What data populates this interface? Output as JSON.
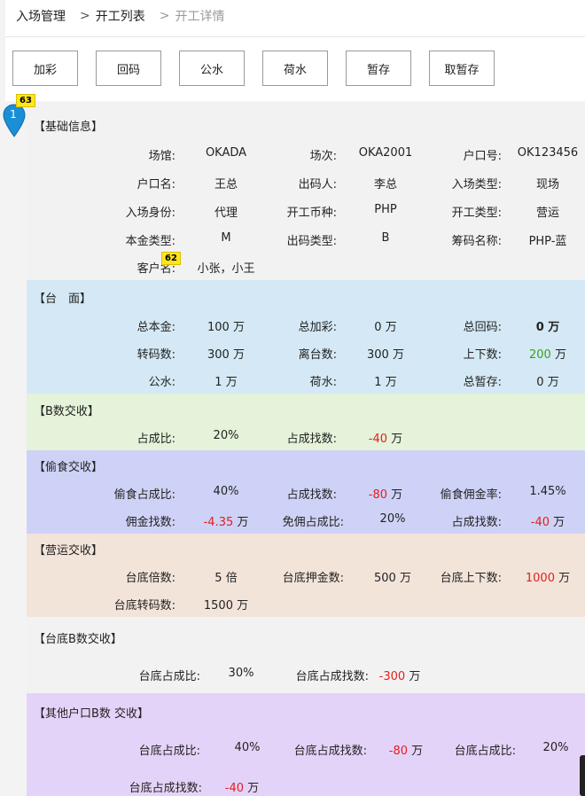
{
  "breadcrumb": {
    "home": "入场管理",
    "sep1": ">",
    "list": "开工列表",
    "sep2": ">",
    "current": "开工详情"
  },
  "toolbar": {
    "b1": "加彩",
    "b2": "回码",
    "b3": "公水",
    "b4": "荷水",
    "b5": "暂存",
    "b6": "取暂存"
  },
  "marker": {
    "label": "1",
    "badge": "63"
  },
  "badge2": "62",
  "basic": {
    "title": "【基础信息】",
    "venue_l": "场馆:",
    "venue_v": "OKADA",
    "session_l": "场次:",
    "session_v": "OKA2001",
    "acct_l": "户口号:",
    "acct_v": "OK123456",
    "name_l": "户口名:",
    "name_v": "王总",
    "issuer_l": "出码人:",
    "issuer_v": "李总",
    "entry_l": "入场类型:",
    "entry_v": "现场",
    "role_l": "入场身份:",
    "role_v": "代理",
    "currency_l": "开工币种:",
    "currency_v": "PHP",
    "worktype_l": "开工类型:",
    "worktype_v": "营运",
    "principal_l": "本金类型:",
    "principal_v": "M",
    "codetype_l": "出码类型:",
    "codetype_v": "B",
    "chipname_l": "筹码名称:",
    "chipname_v": "PHP-蓝",
    "client_l": "客户名:",
    "client_v": "小张，小王"
  },
  "table": {
    "title": "【台　面】",
    "r1": [
      "总本金:",
      "100 万",
      "总加彩:",
      "0 万",
      "总回码:",
      "0 万"
    ],
    "r2": [
      "转码数:",
      "300 万",
      "离台数:",
      "300 万",
      "上下数:",
      "200",
      "万"
    ],
    "r3": [
      "公水:",
      "1 万",
      "荷水:",
      "1 万",
      "总暂存:",
      "0 万"
    ]
  },
  "bsettle": {
    "title": "【B数交收】",
    "r1": [
      "占成比:",
      "20%",
      "占成找数:",
      "-40",
      "万"
    ]
  },
  "steal": {
    "title": "【偷食交收】",
    "r1": [
      "偷食占成比:",
      "40%",
      "占成找数:",
      "-80",
      "万",
      "偷食佣金率:",
      "1.45%"
    ],
    "r2": [
      "佣金找数:",
      "-4.35",
      "万",
      "免佣占成比:",
      "20%",
      "占成找数:",
      "-40",
      "万"
    ]
  },
  "ops": {
    "title": "【营运交收】",
    "r1": [
      "台底倍数:",
      "5 倍",
      "台底押金数:",
      "500 万",
      "台底上下数:",
      "1000",
      "万"
    ],
    "r2": [
      "台底转码数:",
      "1500 万"
    ]
  },
  "floorb": {
    "title": "【台底B数交收】",
    "r1": [
      "台底占成比:",
      "30%",
      "台底占成找数:",
      "-300",
      "万"
    ]
  },
  "other": {
    "title": "【其他户口B数 交收】",
    "r1": [
      "台底占成比:",
      "40%",
      "台底占成找数:",
      "-80",
      "万",
      "台底占成比:",
      "20%"
    ],
    "r2": [
      "台底占成找数:",
      "-40",
      "万"
    ]
  },
  "colors": {
    "basic": "#f2f2f2",
    "table": "#d4e9f5",
    "bsettle": "#e4f3d9",
    "steal": "#cfd2f7",
    "ops": "#f3e4da",
    "floorb": "#f2f2f2",
    "other": "#e4d3f8",
    "green": "#3aa020",
    "red": "#e0201e"
  }
}
